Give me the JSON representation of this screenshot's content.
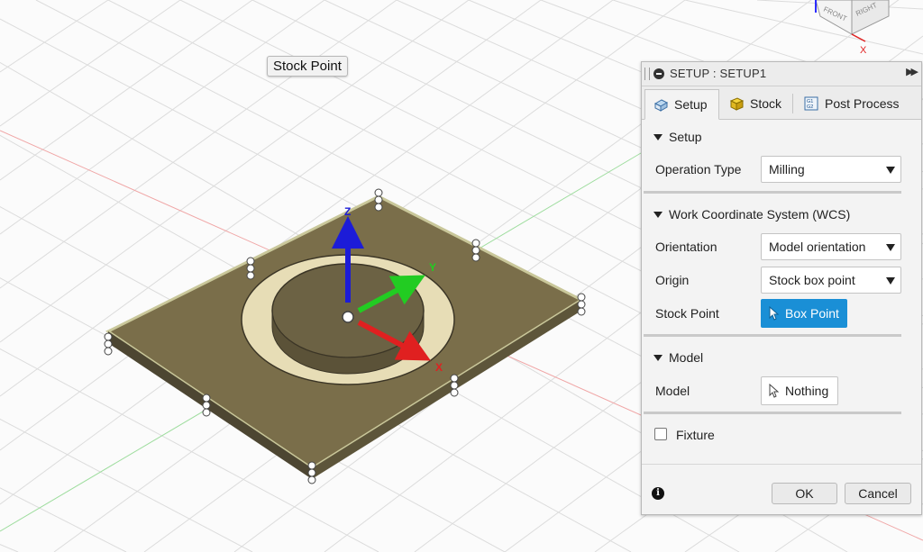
{
  "viewport": {
    "tooltip": "Stock Point",
    "viewcube": {
      "front": "FRONT",
      "right": "RIGHT",
      "x": "X"
    },
    "axes": {
      "z": "Z",
      "y": "Y",
      "x": "X"
    },
    "colors": {
      "z_axis": "#1c1cd8",
      "y_axis": "#22cc22",
      "x_axis": "#e02020",
      "stock_top": "#7a6e4a",
      "grid": "#d8d8d8"
    }
  },
  "panel": {
    "title": "SETUP : SETUP1",
    "tabs": [
      {
        "label": "Setup",
        "icon": "setup-icon"
      },
      {
        "label": "Stock",
        "icon": "stock-cube-icon"
      },
      {
        "label": "Post Process",
        "icon": "post-process-icon",
        "icon_text": "G1G2"
      }
    ],
    "setup_section": {
      "heading": "Setup",
      "operation_type_label": "Operation Type",
      "operation_type_value": "Milling"
    },
    "wcs_section": {
      "heading": "Work Coordinate System (WCS)",
      "orientation_label": "Orientation",
      "orientation_value": "Model orientation",
      "origin_label": "Origin",
      "origin_value": "Stock box point",
      "stock_point_label": "Stock Point",
      "stock_point_value": "Box Point"
    },
    "model_section": {
      "heading": "Model",
      "model_label": "Model",
      "model_value": "Nothing"
    },
    "fixture_label": "Fixture",
    "ok_label": "OK",
    "cancel_label": "Cancel",
    "accent_color": "#1a8fd6"
  }
}
